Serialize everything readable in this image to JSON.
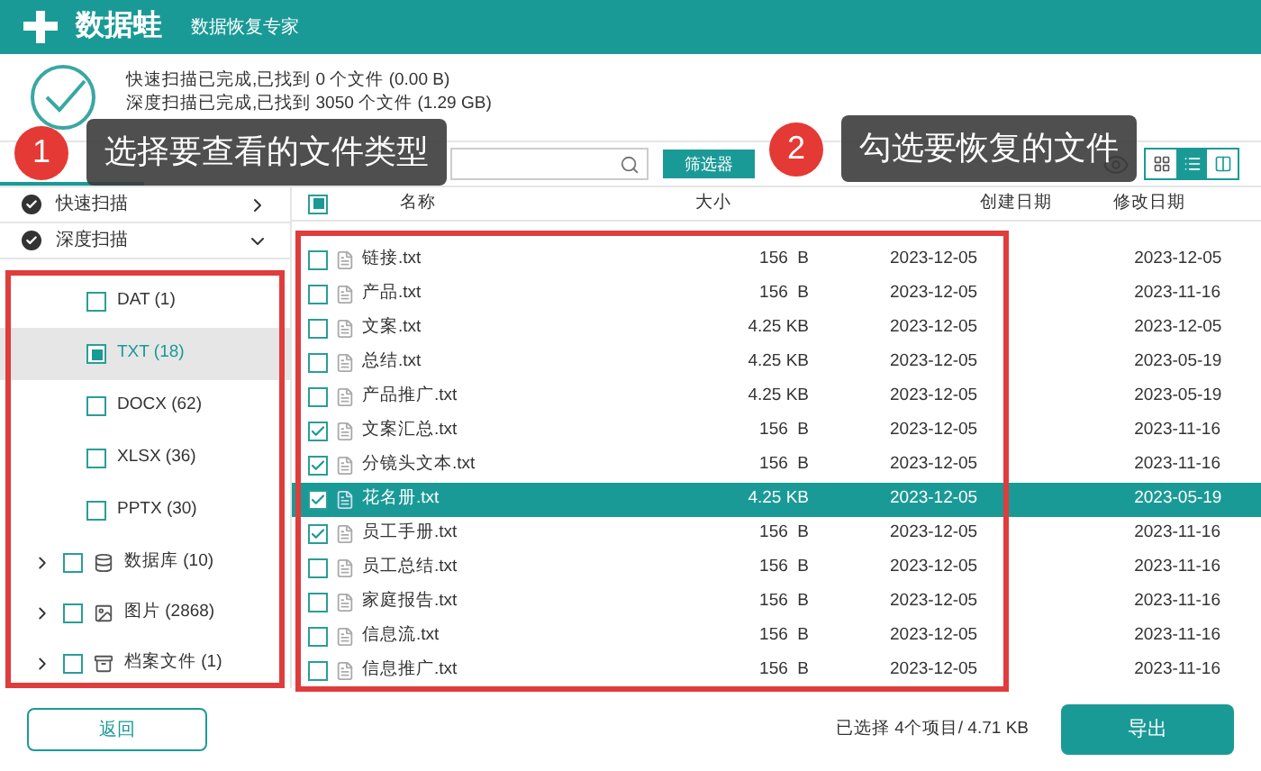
{
  "header": {
    "brand": "数据蛙",
    "subtitle": "数据恢复专家"
  },
  "summary": [
    "快速扫描已完成,已找到 0 个文件 (0.00  B)",
    "深度扫描已完成,已找到 3050 个文件 (1.29 GB)"
  ],
  "toolbar": {
    "filter_button": "筛选器"
  },
  "sidebar": {
    "sections": [
      {
        "label": "快速扫描",
        "expanded": false
      },
      {
        "label": "深度扫描",
        "expanded": true
      }
    ],
    "items": [
      {
        "kind": "type",
        "label": "DAT (1)",
        "partial": false,
        "selected": false
      },
      {
        "kind": "type",
        "label": "TXT (18)",
        "partial": true,
        "selected": true
      },
      {
        "kind": "type",
        "label": "DOCX (62)",
        "partial": false,
        "selected": false
      },
      {
        "kind": "type",
        "label": "XLSX (36)",
        "partial": false,
        "selected": false
      },
      {
        "kind": "type",
        "label": "PPTX (30)",
        "partial": false,
        "selected": false
      },
      {
        "kind": "database",
        "label": "数据库 (10)",
        "partial": false,
        "selected": false
      },
      {
        "kind": "image",
        "label": "图片 (2868)",
        "partial": false,
        "selected": false
      },
      {
        "kind": "archive",
        "label": "档案文件 (1)",
        "partial": false,
        "selected": false
      }
    ]
  },
  "table": {
    "header_partial": true,
    "columns": [
      "名称",
      "大小",
      "创建日期",
      "修改日期"
    ],
    "rows": [
      {
        "name": "链接.txt",
        "size": "156  B",
        "created": "2023-12-05",
        "modified": "2023-12-05",
        "checked": false,
        "selected": false
      },
      {
        "name": "产品.txt",
        "size": "156  B",
        "created": "2023-12-05",
        "modified": "2023-11-16",
        "checked": false,
        "selected": false
      },
      {
        "name": "文案.txt",
        "size": "4.25 KB",
        "created": "2023-12-05",
        "modified": "2023-12-05",
        "checked": false,
        "selected": false
      },
      {
        "name": "总结.txt",
        "size": "4.25 KB",
        "created": "2023-12-05",
        "modified": "2023-05-19",
        "checked": false,
        "selected": false
      },
      {
        "name": "产品推广.txt",
        "size": "4.25 KB",
        "created": "2023-12-05",
        "modified": "2023-05-19",
        "checked": false,
        "selected": false
      },
      {
        "name": "文案汇总.txt",
        "size": "156  B",
        "created": "2023-12-05",
        "modified": "2023-11-16",
        "checked": true,
        "selected": false
      },
      {
        "name": "分镜头文本.txt",
        "size": "156  B",
        "created": "2023-12-05",
        "modified": "2023-11-16",
        "checked": true,
        "selected": false
      },
      {
        "name": "花名册.txt",
        "size": "4.25 KB",
        "created": "2023-12-05",
        "modified": "2023-05-19",
        "checked": true,
        "selected": true
      },
      {
        "name": "员工手册.txt",
        "size": "156  B",
        "created": "2023-12-05",
        "modified": "2023-11-16",
        "checked": true,
        "selected": false
      },
      {
        "name": "员工总结.txt",
        "size": "156  B",
        "created": "2023-12-05",
        "modified": "2023-11-16",
        "checked": false,
        "selected": false
      },
      {
        "name": "家庭报告.txt",
        "size": "156  B",
        "created": "2023-12-05",
        "modified": "2023-11-16",
        "checked": false,
        "selected": false
      },
      {
        "name": "信息流.txt",
        "size": "156  B",
        "created": "2023-12-05",
        "modified": "2023-11-16",
        "checked": false,
        "selected": false
      },
      {
        "name": "信息推广.txt",
        "size": "156  B",
        "created": "2023-12-05",
        "modified": "2023-11-16",
        "checked": false,
        "selected": false
      }
    ]
  },
  "callouts": [
    {
      "number": "1",
      "text": "选择要查看的文件类型"
    },
    {
      "number": "2",
      "text": "勾选要恢复的文件"
    }
  ],
  "footer": {
    "back_button": "返回",
    "selection": "已选择 4个项目/ 4.71 KB",
    "export_button": "导出"
  }
}
